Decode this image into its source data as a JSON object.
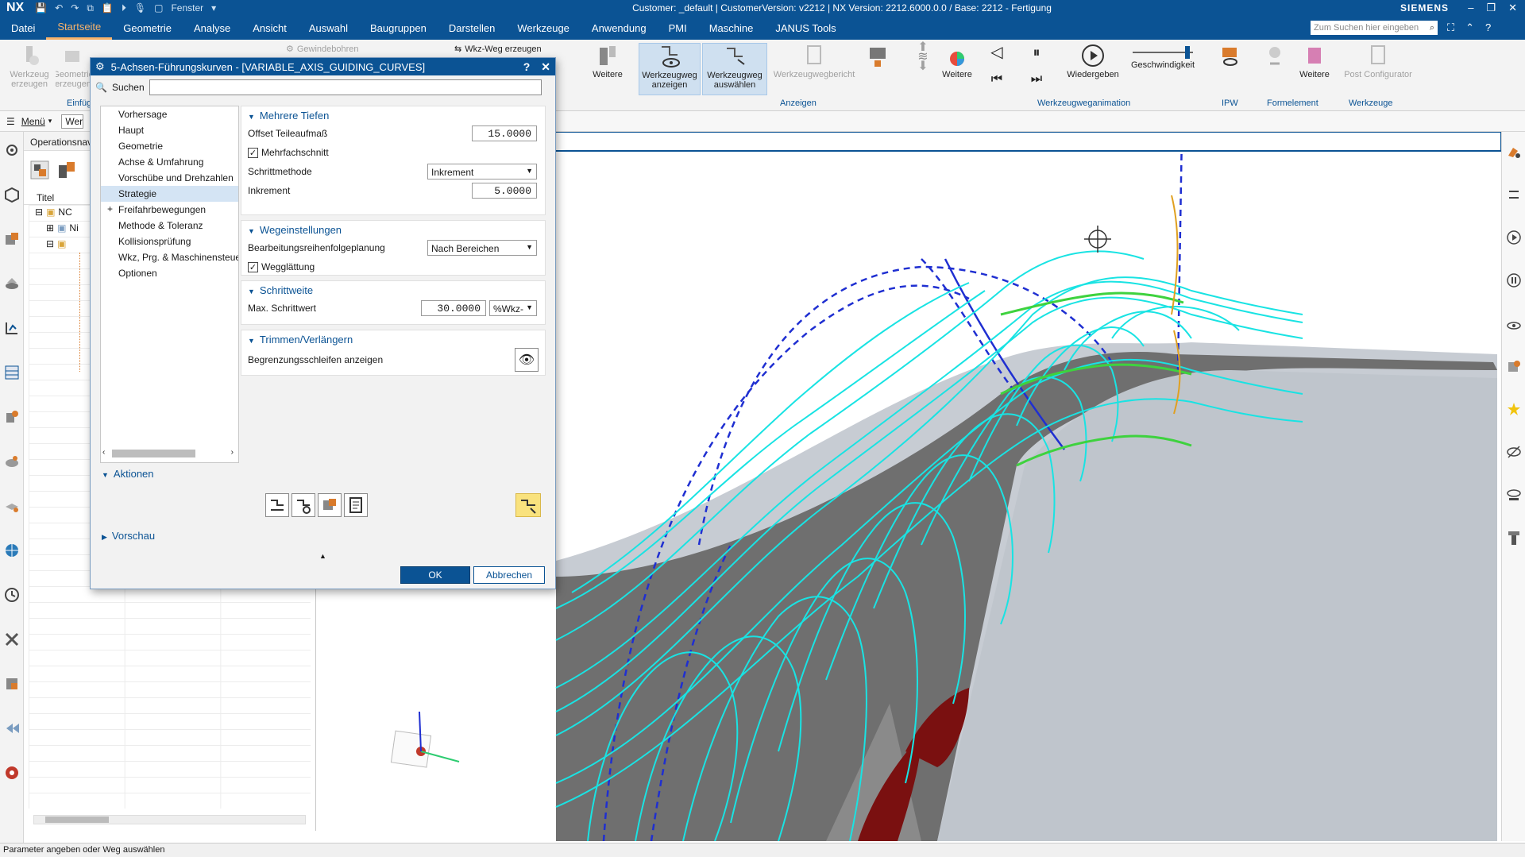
{
  "titlebar": {
    "logo": "NX",
    "window_menu": "Fenster",
    "title": "Customer: _default | CustomerVersion: v2212 | NX Version: 2212.6000.0.0 / Base: 2212 - Fertigung",
    "brand": "SIEMENS"
  },
  "menu": {
    "tabs": [
      "Datei",
      "Startseite",
      "Geometrie",
      "Analyse",
      "Ansicht",
      "Auswahl",
      "Baugruppen",
      "Darstellen",
      "Werkzeuge",
      "Anwendung",
      "PMI",
      "Maschine",
      "JANUS Tools"
    ],
    "search_placeholder": "Zum Suchen hier eingeben"
  },
  "ribbon": {
    "create_tool": "Werkzeug erzeugen",
    "geometry_create": "Geometrie erzeugen",
    "insert_group": "Einfügen",
    "threaded_hole": "Gewindebohren",
    "create_toolpath": "Wkz-Weg erzeugen",
    "more1": "Weitere",
    "show_toolpath": "Werkzeugweg anzeigen",
    "select_toolpath": "Werkzeugweg auswählen",
    "toolpath_report": "Werkzeugwegbericht",
    "more2": "Weitere",
    "display_group": "Anzeigen",
    "play": "Wiedergeben",
    "speed": "Geschwindigkeit",
    "animation_group": "Werkzeugweganimation",
    "ipw_group": "IPW",
    "more3": "Weitere",
    "form_group": "Formelement",
    "post_configurator": "Post Configurator",
    "tools_group": "Werkzeuge"
  },
  "toolbar2": {
    "menu_label": "Menü",
    "filter_value": "Wer"
  },
  "navigator": {
    "title": "Operationsnav",
    "col_title": "Titel",
    "nodes": [
      "NC",
      "Ni"
    ]
  },
  "dialog": {
    "title": "5-Achsen-Führungskurven - [VARIABLE_AXIS_GUIDING_CURVES]",
    "help": "?",
    "close": "✕",
    "search_label": "Suchen",
    "search_value": "",
    "list": [
      "Vorhersage",
      "Haupt",
      "Geometrie",
      "Achse & Umfahrung",
      "Vorschübe und Drehzahlen",
      "Strategie",
      "Freifahrbewegungen",
      "Methode & Toleranz",
      "Kollisionsprüfung",
      "Wkz, Prg. & Maschinensteuerung",
      "Optionen"
    ],
    "selected_item": "Strategie",
    "sections": {
      "depth": {
        "header": "Mehrere Tiefen",
        "offset_label": "Offset Teileaufmaß",
        "offset_value": "15.0000",
        "multi_cut_label": "Mehrfachschnitt",
        "step_method_label": "Schrittmethode",
        "step_method_value": "Inkrement",
        "increment_label": "Inkrement",
        "increment_value": "5.0000"
      },
      "path": {
        "header": "Wegeinstellungen",
        "order_label": "Bearbeitungsreihenfolgeplanung",
        "order_value": "Nach Bereichen",
        "smoothing_label": "Wegglättung"
      },
      "stepover": {
        "header": "Schrittweite",
        "max_label": "Max. Schrittwert",
        "max_value": "30.0000",
        "unit_value": "%Wkz-"
      },
      "trim": {
        "header": "Trimmen/Verlängern",
        "boundary_label": "Begrenzungsschleifen anzeigen"
      }
    },
    "actions_header": "Aktionen",
    "preview_header": "Vorschau",
    "ok": "OK",
    "cancel": "Abbrechen"
  },
  "status": {
    "text": "Parameter angeben oder Weg auswählen"
  },
  "colors": {
    "brand_blue": "#0b5394",
    "active_tab": "#f6b26b",
    "toolpath": "#19e3e3",
    "guide_curve": "#1f2fd1",
    "part_grey": "#7a7a7a",
    "highlight": "#f9e27e"
  }
}
